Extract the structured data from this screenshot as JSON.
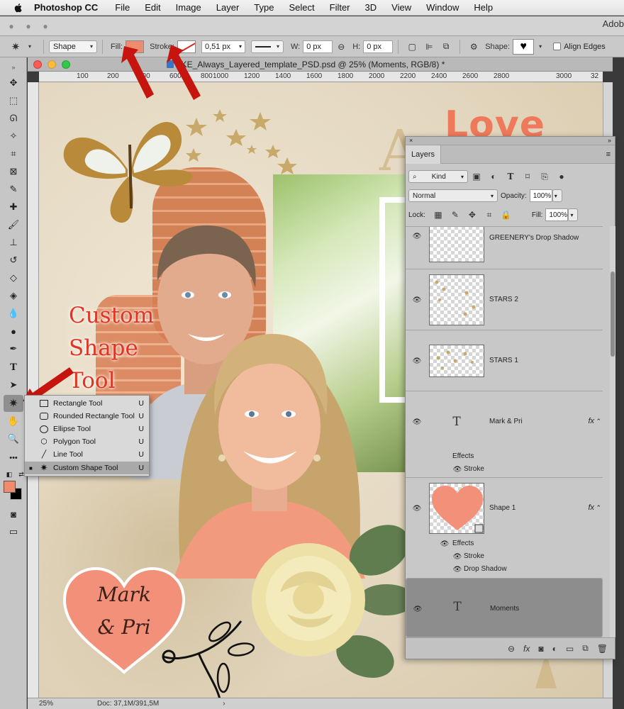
{
  "menubar": {
    "app_name": "Photoshop CC",
    "items": [
      "File",
      "Edit",
      "Image",
      "Layer",
      "Type",
      "Select",
      "Filter",
      "3D",
      "View",
      "Window",
      "Help"
    ],
    "right_text": "Adob"
  },
  "options": {
    "mode": "Shape",
    "fill_label": "Fill:",
    "stroke_label": "Stroke:",
    "stroke_width": "0,51 px",
    "w_label": "W:",
    "w_value": "0 px",
    "h_label": "H:",
    "h_value": "0 px",
    "shape_label": "Shape:",
    "align_edges": "Align Edges",
    "fill_color": "#f08c6e",
    "stroke_color": "#ffffff"
  },
  "document": {
    "tab_title": "LKE_Always_Layered_template_PSD.psd @ 25% (Moments, RGB/8) *",
    "ruler_ticks": [
      "100",
      "200",
      "400",
      "600",
      "800",
      "1000",
      "1200",
      "1400",
      "1600",
      "1800",
      "2000",
      "2200",
      "2400",
      "2600",
      "2800",
      "3000",
      "32"
    ],
    "zoom": "25%",
    "doc_size": "Doc: 37,1M/391,5M"
  },
  "canvas": {
    "love_text": "Love",
    "big_letter": "A",
    "annotation_lines": [
      "Custom",
      "Shape",
      "Tool"
    ],
    "heart_lines": [
      "Mark",
      "& Pri"
    ]
  },
  "flyout": {
    "items": [
      {
        "label": "Rectangle Tool",
        "key": "U"
      },
      {
        "label": "Rounded Rectangle Tool",
        "key": "U"
      },
      {
        "label": "Ellipse Tool",
        "key": "U"
      },
      {
        "label": "Polygon Tool",
        "key": "U"
      },
      {
        "label": "Line Tool",
        "key": "U"
      },
      {
        "label": "Custom Shape Tool",
        "key": "U"
      }
    ]
  },
  "layers": {
    "tab": "Layers",
    "filter_kind": "Kind",
    "blend_mode": "Normal",
    "opacity_label": "Opacity:",
    "opacity": "100%",
    "lock_label": "Lock:",
    "fill_label": "Fill:",
    "fill": "100%",
    "items": [
      {
        "name": "GREENERY's Drop Shadow"
      },
      {
        "name": "STARS 2"
      },
      {
        "name": "STARS 1"
      },
      {
        "name": "Mark & Pri",
        "effects": "Effects",
        "sub": [
          "Stroke"
        ]
      },
      {
        "name": "Shape 1",
        "effects": "Effects",
        "sub": [
          "Stroke",
          "Drop Shadow"
        ]
      },
      {
        "name": "Moments"
      }
    ],
    "fx": "fx",
    "type_glyph": "T"
  },
  "colors": {
    "accent_red": "#e53321",
    "love_orange": "#ef7a5b",
    "heart_fill": "#f2907a"
  }
}
